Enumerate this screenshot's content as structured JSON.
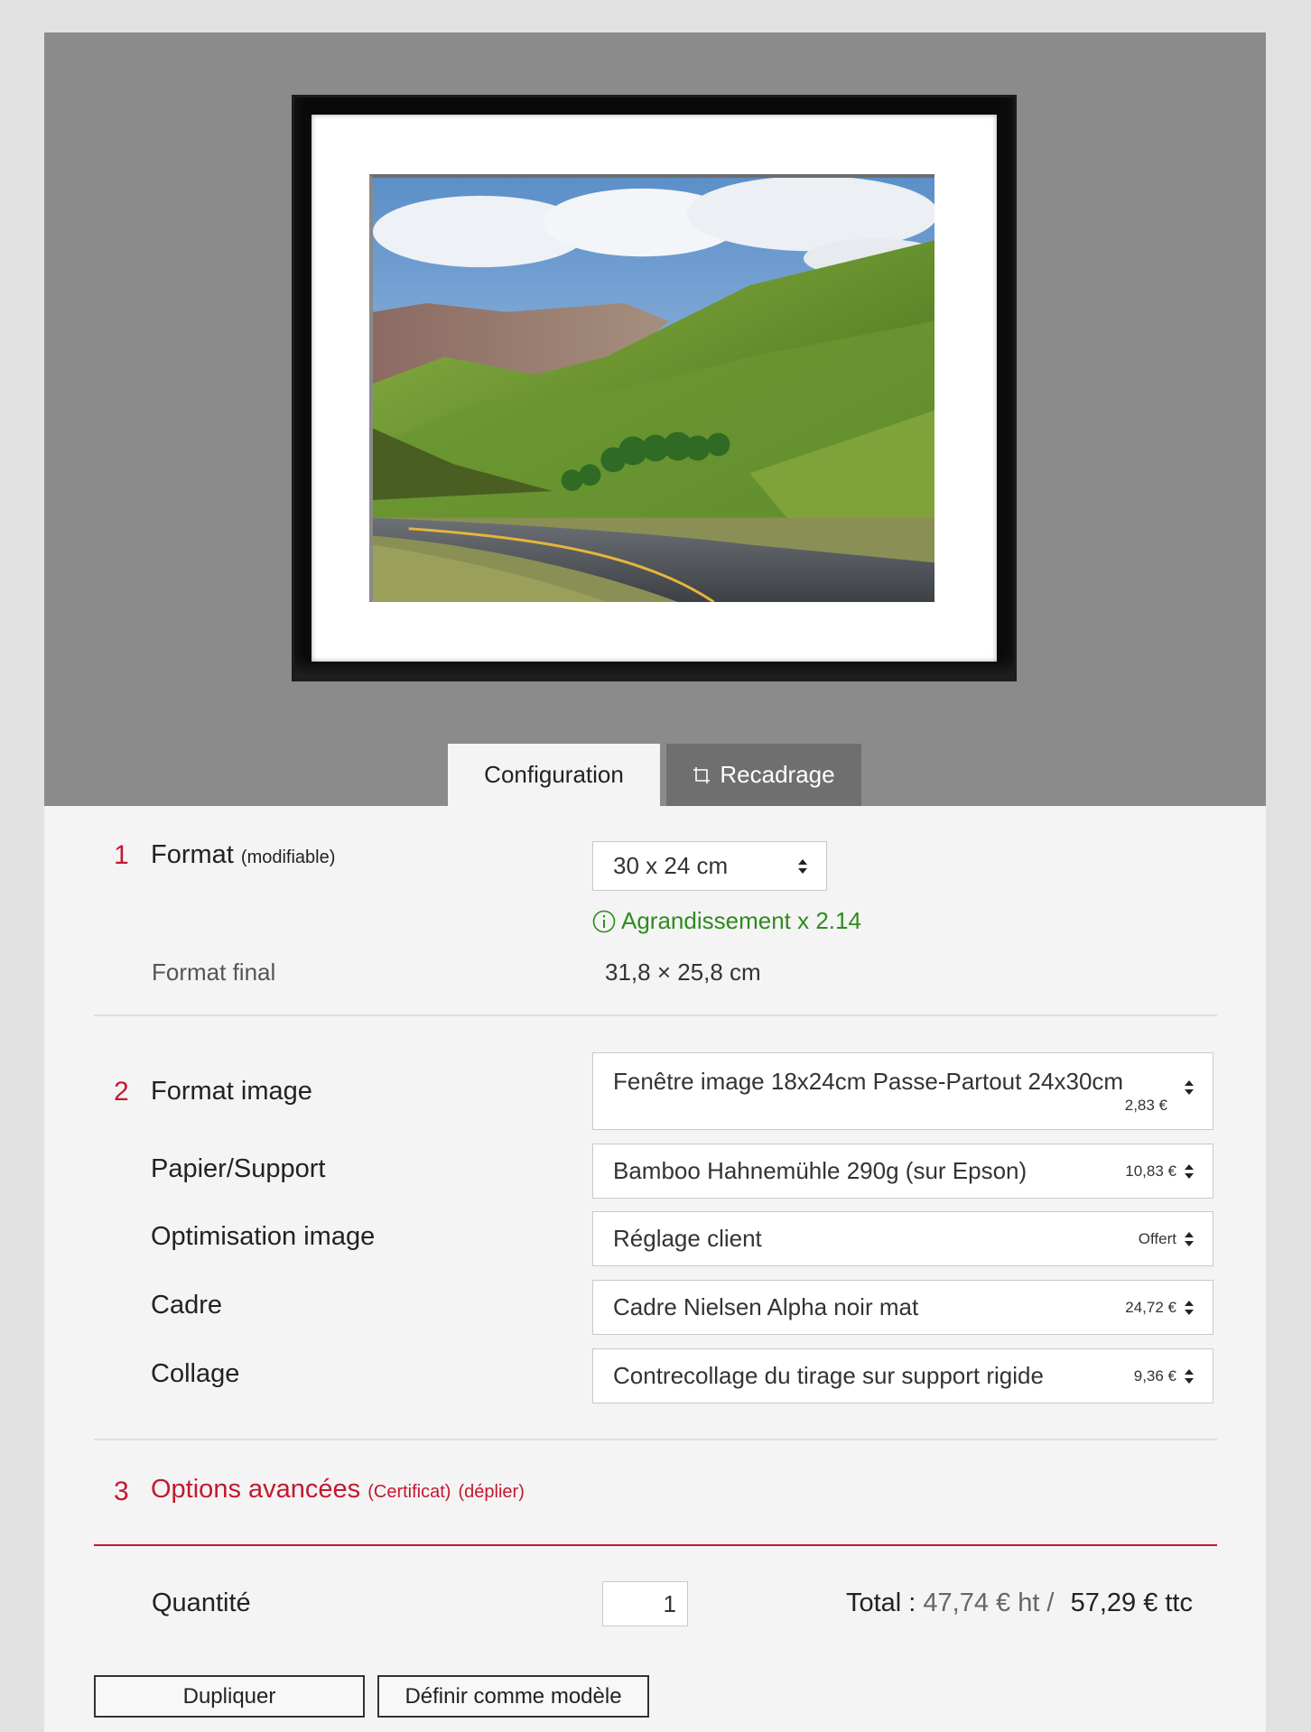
{
  "tabs": {
    "configuration": "Configuration",
    "recadrage": "Recadrage"
  },
  "section1": {
    "number": "1",
    "title": "Format",
    "title_note": "(modifiable)",
    "format_select": "30 x 24 cm",
    "enlargement": "Agrandissement x 2.14",
    "final_label": "Format final",
    "final_value": "31,8 × 25,8 cm"
  },
  "section2": {
    "number": "2",
    "rows": [
      {
        "label": "Format image",
        "value": "Fenêtre image 18x24cm Passe-Partout 24x30cm",
        "price": "2,83 €"
      },
      {
        "label": "Papier/Support",
        "value": "Bamboo Hahnemühle 290g (sur Epson)",
        "price": "10,83 €"
      },
      {
        "label": "Optimisation image",
        "value": "Réglage client",
        "price": "Offert"
      },
      {
        "label": "Cadre",
        "value": "Cadre Nielsen Alpha noir mat",
        "price": "24,72 €"
      },
      {
        "label": "Collage",
        "value": "Contrecollage du tirage sur support rigide",
        "price": "9,36 €"
      }
    ]
  },
  "section3": {
    "number": "3",
    "title": "Options avancées",
    "note1": "(Certificat)",
    "note2": "(déplier)"
  },
  "order": {
    "quantity_label": "Quantité",
    "quantity_value": "1",
    "total_label": "Total :",
    "total_ht": "47,74 € ht /",
    "total_ttc": "57,29 € ttc"
  },
  "buttons": {
    "duplicate": "Dupliquer",
    "set_template": "Définir comme modèle"
  },
  "colors": {
    "accent_red": "#c4182f",
    "success_green": "#2e8b1e",
    "preview_bg": "#8b8b8b"
  },
  "icons": [
    "crop-icon",
    "info-icon",
    "select-arrows-icon"
  ]
}
